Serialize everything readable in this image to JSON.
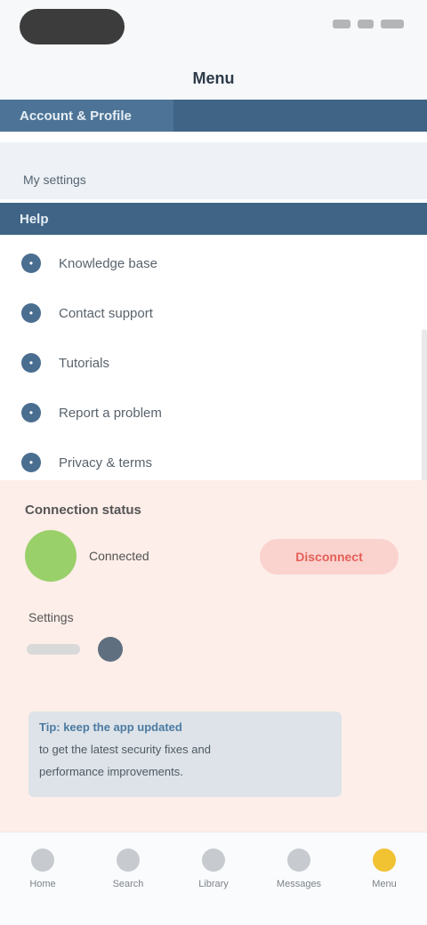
{
  "status_bar": {
    "icons": [
      "signal-icon",
      "wifi-icon",
      "battery-icon"
    ]
  },
  "header": {
    "title": "Menu"
  },
  "band1": {
    "label": "Account & Profile"
  },
  "group": {
    "label": "My settings"
  },
  "band2": {
    "label": "Help"
  },
  "list": {
    "items": [
      {
        "label": "Knowledge base"
      },
      {
        "label": "Contact support"
      },
      {
        "label": "Tutorials"
      },
      {
        "label": "Report a problem"
      },
      {
        "label": "Privacy & terms"
      }
    ]
  },
  "status": {
    "section_title": "Connection status",
    "state": "Connected",
    "action_label": "Disconnect"
  },
  "settings": {
    "label": "Settings"
  },
  "note": {
    "line1": "Tip: keep the app updated",
    "line2": "to get the latest security fixes and",
    "line3": "performance improvements."
  },
  "tabs": [
    {
      "label": "Home"
    },
    {
      "label": "Search"
    },
    {
      "label": "Library"
    },
    {
      "label": "Messages"
    },
    {
      "label": "Menu"
    }
  ],
  "colors": {
    "primary": "#3f6486",
    "accent": "#f1c232",
    "status_ok": "#9ad06a",
    "danger": "#e45f57"
  }
}
